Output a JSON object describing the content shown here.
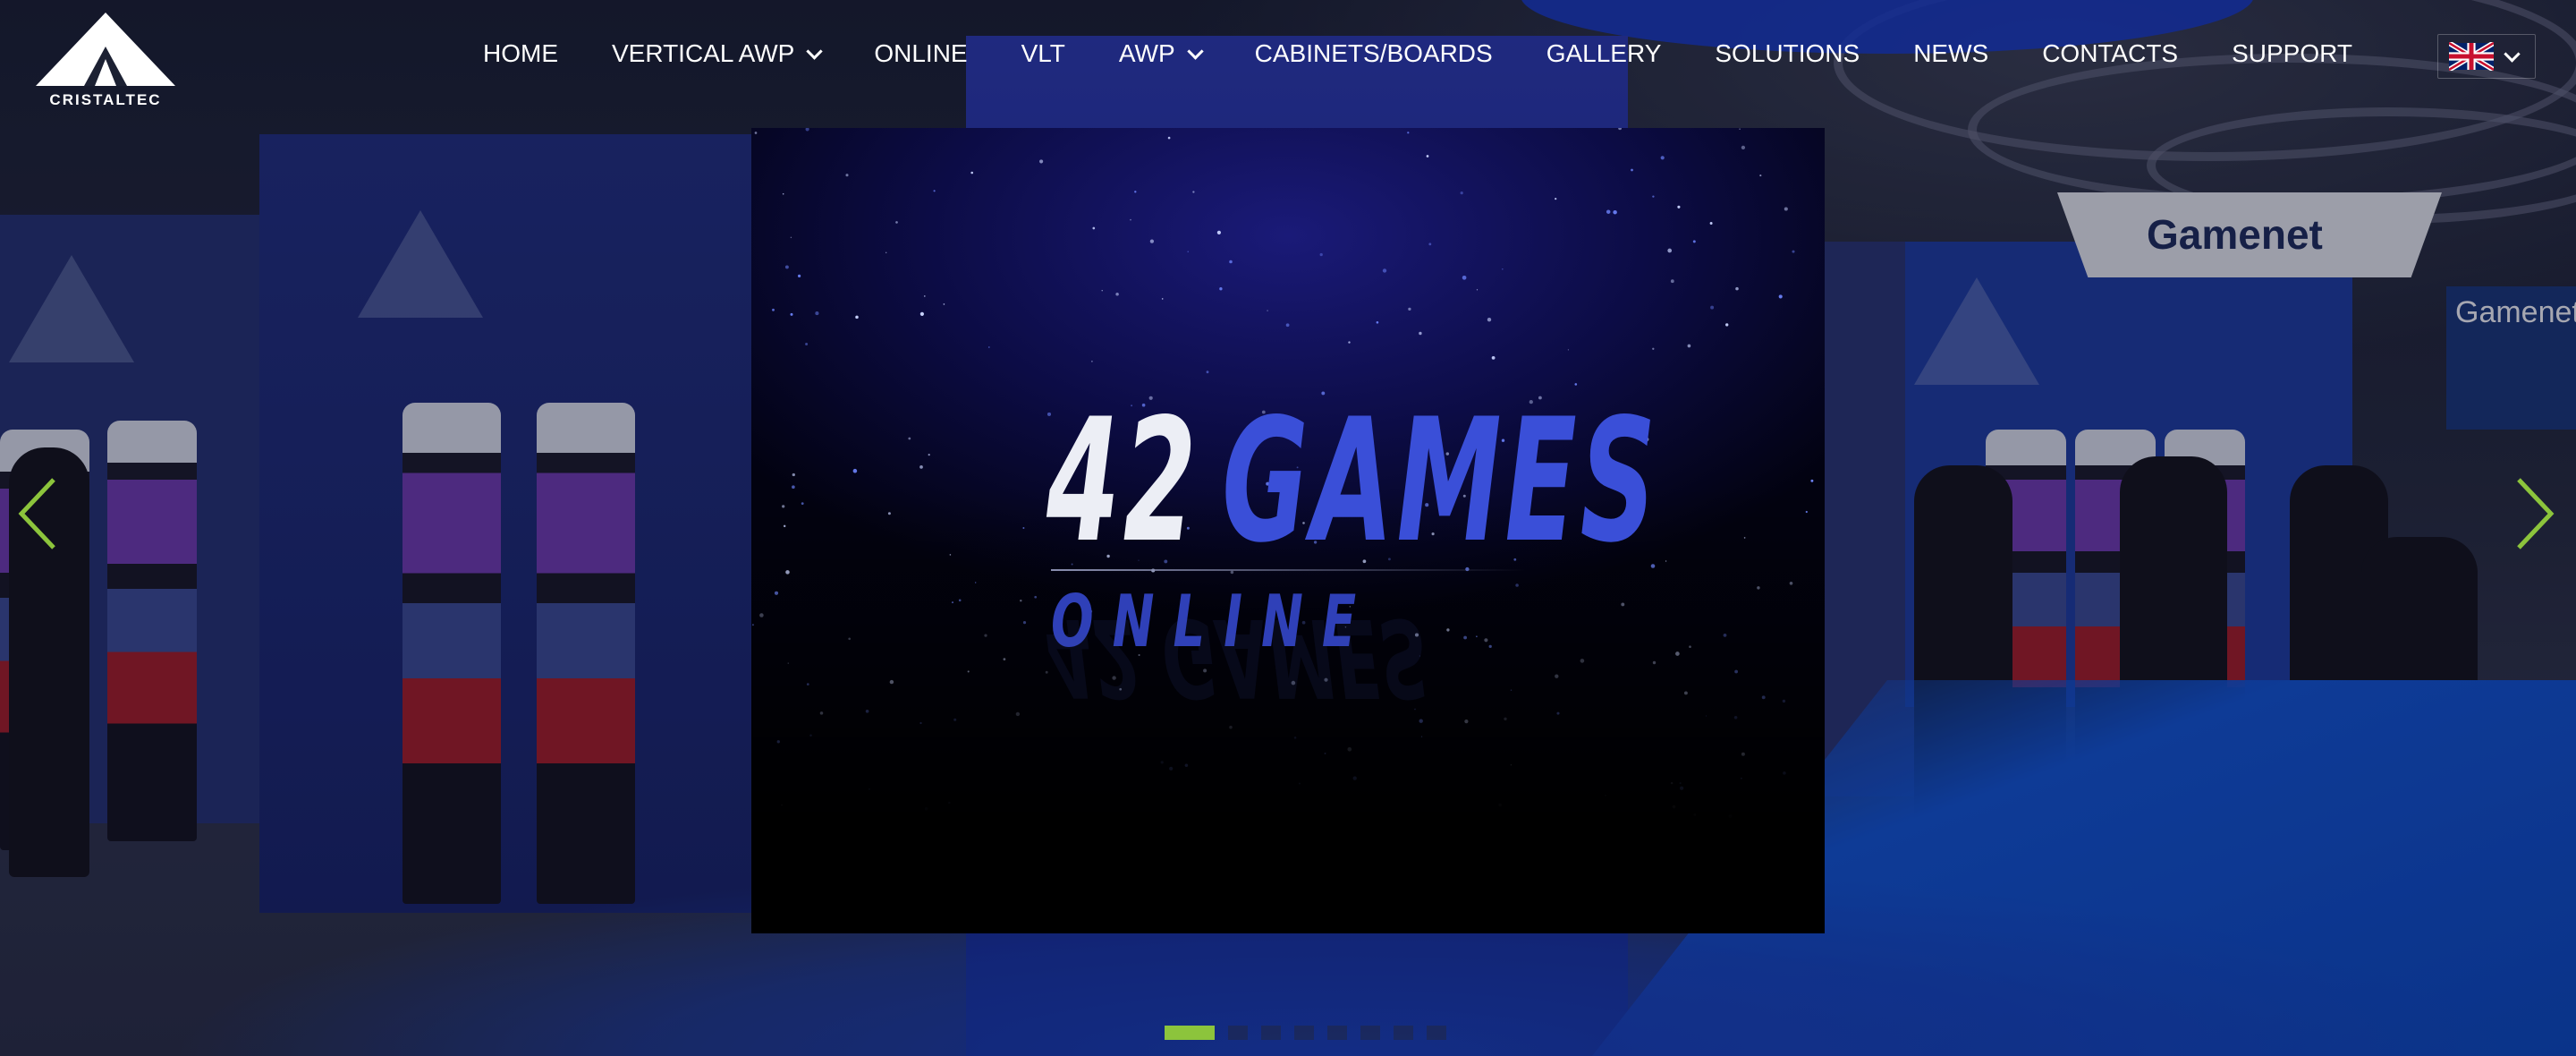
{
  "brand": {
    "logo_text": "CRISTALTEC",
    "accent_color": "#8cc43c"
  },
  "nav": {
    "items": [
      {
        "label": "HOME",
        "has_dropdown": false
      },
      {
        "label": "VERTICAL AWP",
        "has_dropdown": true
      },
      {
        "label": "ONLINE",
        "has_dropdown": false
      },
      {
        "label": "VLT",
        "has_dropdown": false
      },
      {
        "label": "AWP",
        "has_dropdown": true
      },
      {
        "label": "CABINETS/BOARDS",
        "has_dropdown": false
      },
      {
        "label": "GALLERY",
        "has_dropdown": false
      },
      {
        "label": "SOLUTIONS",
        "has_dropdown": false
      },
      {
        "label": "NEWS",
        "has_dropdown": false
      },
      {
        "label": "CONTACTS",
        "has_dropdown": false
      },
      {
        "label": "SUPPORT",
        "has_dropdown": false
      }
    ],
    "language": {
      "icon": "uk-flag-icon",
      "has_dropdown": true
    }
  },
  "slider": {
    "video": {
      "number": "42",
      "word": "GAMES",
      "subtitle": "ONLINE"
    },
    "background_signs": {
      "sign_main": "Gamenet",
      "sign_side": "Gamenet"
    },
    "prev_icon": "chevron-left-icon",
    "next_icon": "chevron-right-icon",
    "dots_total": 8,
    "active_dot": 1
  }
}
